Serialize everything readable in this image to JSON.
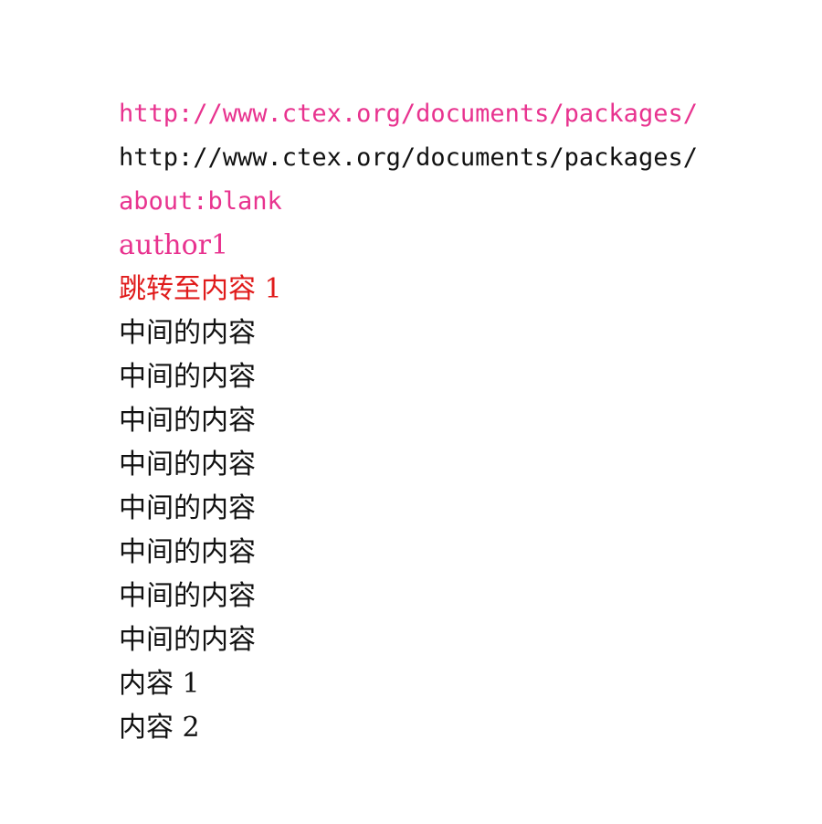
{
  "document": {
    "colors": {
      "link": "#e8338f",
      "internal_link": "#e01b1b",
      "text": "#111111",
      "background": "#ffffff"
    },
    "lines": {
      "url_link_colored": "http://www.ctex.org/documents/packages/",
      "url_plain": "http://www.ctex.org/documents/packages/",
      "about_blank_link": "about:blank",
      "author_link": "author1",
      "jump_link": "跳转至内容 1",
      "middle_content": [
        "中间的内容",
        "中间的内容",
        "中间的内容",
        "中间的内容",
        "中间的内容",
        "中间的内容",
        "中间的内容",
        "中间的内容"
      ],
      "content_1": "内容 1",
      "content_2": "内容 2"
    }
  }
}
